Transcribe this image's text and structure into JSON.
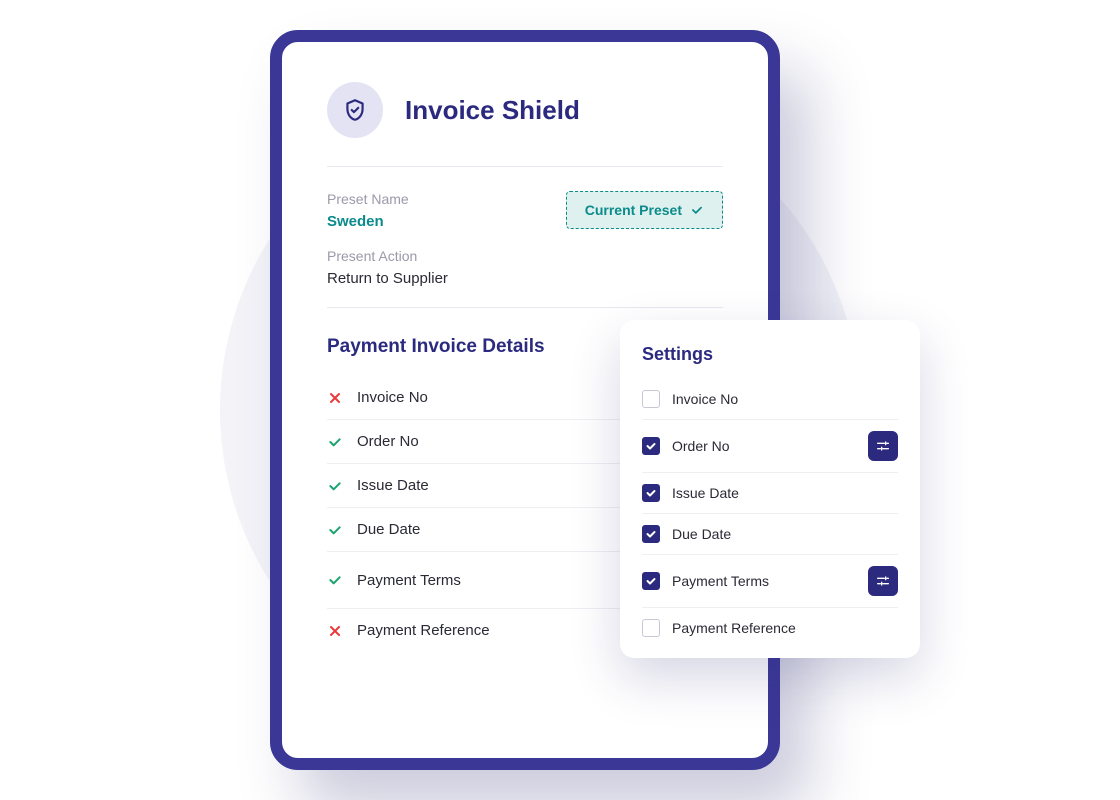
{
  "header": {
    "title": "Invoice Shield",
    "icon": "shield-check-icon"
  },
  "preset": {
    "name_label": "Preset Name",
    "name_value": "Sweden",
    "badge_label": "Current Preset",
    "action_label": "Present Action",
    "action_value": "Return to Supplier"
  },
  "details": {
    "section_title": "Payment Invoice Details",
    "items": [
      {
        "label": "Invoice No",
        "status": "fail",
        "filter": false
      },
      {
        "label": "Order No",
        "status": "pass",
        "filter": false
      },
      {
        "label": "Issue Date",
        "status": "pass",
        "filter": false
      },
      {
        "label": "Due Date",
        "status": "pass",
        "filter": false
      },
      {
        "label": "Payment Terms",
        "status": "pass",
        "filter": true
      },
      {
        "label": "Payment Reference",
        "status": "fail",
        "filter": false
      }
    ]
  },
  "settings": {
    "title": "Settings",
    "items": [
      {
        "label": "Invoice No",
        "checked": false,
        "filter": false
      },
      {
        "label": "Order No",
        "checked": true,
        "filter": true
      },
      {
        "label": "Issue Date",
        "checked": true,
        "filter": false
      },
      {
        "label": "Due Date",
        "checked": true,
        "filter": false
      },
      {
        "label": "Payment Terms",
        "checked": true,
        "filter": true
      },
      {
        "label": "Payment Reference",
        "checked": false,
        "filter": false
      }
    ]
  },
  "colors": {
    "brand": "#2b2a7f",
    "teal": "#0b8b8b",
    "pass": "#1aa36e",
    "fail": "#e83a3a"
  }
}
